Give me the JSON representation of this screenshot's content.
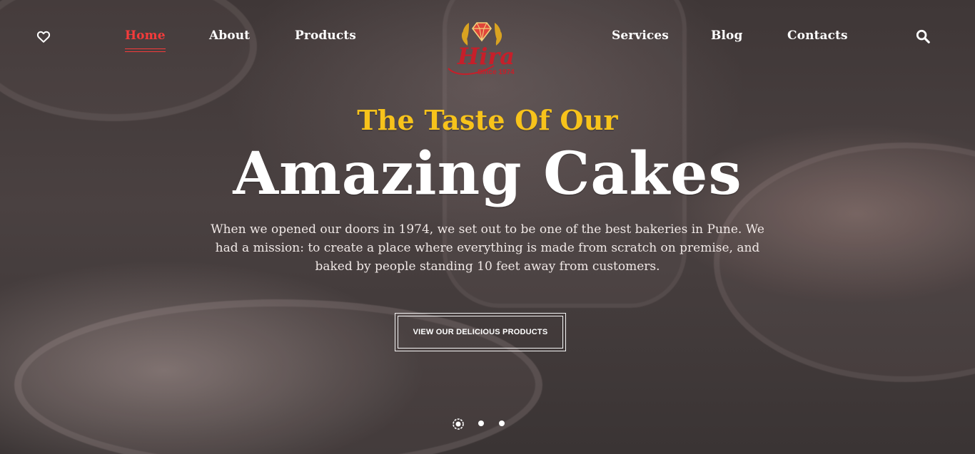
{
  "nav": {
    "left_items": [
      {
        "label": "Home",
        "active": true
      },
      {
        "label": "About",
        "active": false
      },
      {
        "label": "Products",
        "active": false
      }
    ],
    "right_items": [
      {
        "label": "Services",
        "active": false
      },
      {
        "label": "Blog",
        "active": false
      },
      {
        "label": "Contacts",
        "active": false
      }
    ],
    "icons": {
      "favorites": "heart-icon",
      "search": "search-icon"
    }
  },
  "logo": {
    "text": "Hira",
    "subtext": "Since 1974",
    "accent_color": "#c61f2a",
    "gold_color": "#d9a321"
  },
  "hero": {
    "subtitle": "The Taste Of Our",
    "title": "Amazing Cakes",
    "description": "When we opened our doors in 1974, we set out to be one of the best bakeries in Pune. We had a mission: to create a place where everything is made from scratch on premise, and baked by people standing 10 feet away from customers.",
    "cta_label": "VIEW OUR DELICIOUS PRODUCTS"
  },
  "slider": {
    "total_slides": 3,
    "active_index": 0
  },
  "colors": {
    "nav_text": "#ffffff",
    "nav_active": "#f53b3b",
    "subtitle": "#f7c31b",
    "title": "#ffffff"
  }
}
